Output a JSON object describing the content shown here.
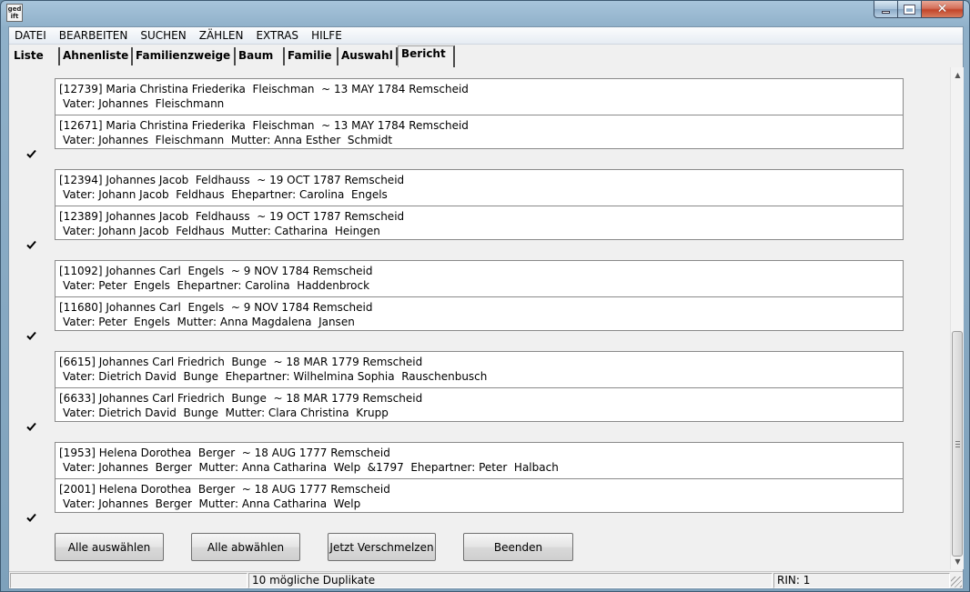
{
  "app": {
    "icon_text": "ged\nift"
  },
  "menu": [
    "DATEI",
    "BEARBEITEN",
    "SUCHEN",
    "ZÄHLEN",
    "EXTRAS",
    "HILFE"
  ],
  "tabs": [
    {
      "label": "Liste",
      "active": false
    },
    {
      "label": "Ahnenliste",
      "active": false
    },
    {
      "label": "Familienzweige",
      "active": false
    },
    {
      "label": "Baum",
      "active": false
    },
    {
      "label": "Familie",
      "active": false
    },
    {
      "label": "Auswahl",
      "active": false
    },
    {
      "label": "Bericht",
      "active": true
    }
  ],
  "groups": [
    {
      "checked": true,
      "entries": [
        {
          "line1": "[12739] Maria Christina Friederika  Fleischman  ~ 13 MAY 1784 Remscheid",
          "line2": "Vater: Johannes  Fleischmann"
        },
        {
          "line1": "[12671] Maria Christina Friederika  Fleischman  ~ 13 MAY 1784 Remscheid",
          "line2": "Vater: Johannes  Fleischmann  Mutter: Anna Esther  Schmidt"
        }
      ]
    },
    {
      "checked": true,
      "entries": [
        {
          "line1": "[12394] Johannes Jacob  Feldhauss  ~ 19 OCT 1787 Remscheid",
          "line2": "Vater: Johann Jacob  Feldhaus  Ehepartner: Carolina  Engels"
        },
        {
          "line1": "[12389] Johannes Jacob  Feldhauss  ~ 19 OCT 1787 Remscheid",
          "line2": "Vater: Johann Jacob  Feldhaus  Mutter: Catharina  Heingen"
        }
      ]
    },
    {
      "checked": true,
      "entries": [
        {
          "line1": "[11092] Johannes Carl  Engels  ~ 9 NOV 1784 Remscheid",
          "line2": "Vater: Peter  Engels  Ehepartner: Carolina  Haddenbrock"
        },
        {
          "line1": "[11680] Johannes Carl  Engels  ~ 9 NOV 1784 Remscheid",
          "line2": "Vater: Peter  Engels  Mutter: Anna Magdalena  Jansen"
        }
      ]
    },
    {
      "checked": true,
      "entries": [
        {
          "line1": "[6615] Johannes Carl Friedrich  Bunge  ~ 18 MAR 1779 Remscheid",
          "line2": "Vater: Dietrich David  Bunge  Ehepartner: Wilhelmina Sophia  Rauschenbusch"
        },
        {
          "line1": "[6633] Johannes Carl Friedrich  Bunge  ~ 18 MAR 1779 Remscheid",
          "line2": "Vater: Dietrich David  Bunge  Mutter: Clara Christina  Krupp"
        }
      ]
    },
    {
      "checked": true,
      "entries": [
        {
          "line1": "[1953] Helena Dorothea  Berger  ~ 18 AUG 1777 Remscheid",
          "line2": "Vater: Johannes  Berger  Mutter: Anna Catharina  Welp  &1797  Ehepartner: Peter  Halbach"
        },
        {
          "line1": "[2001] Helena Dorothea  Berger  ~ 18 AUG 1777 Remscheid",
          "line2": "Vater: Johannes  Berger  Mutter: Anna Catharina  Welp"
        }
      ]
    }
  ],
  "buttons": {
    "select_all": "Alle auswählen",
    "deselect_all": "Alle abwählen",
    "merge_now": "Jetzt Verschmelzen",
    "quit": "Beenden"
  },
  "status": {
    "left": "",
    "center": "10 mögliche Duplikate",
    "right": "RIN: 1"
  },
  "colors": {
    "title_bar": "#8fb0c9",
    "close_button": "#c2452a",
    "client_bg": "#f0f0f0"
  }
}
